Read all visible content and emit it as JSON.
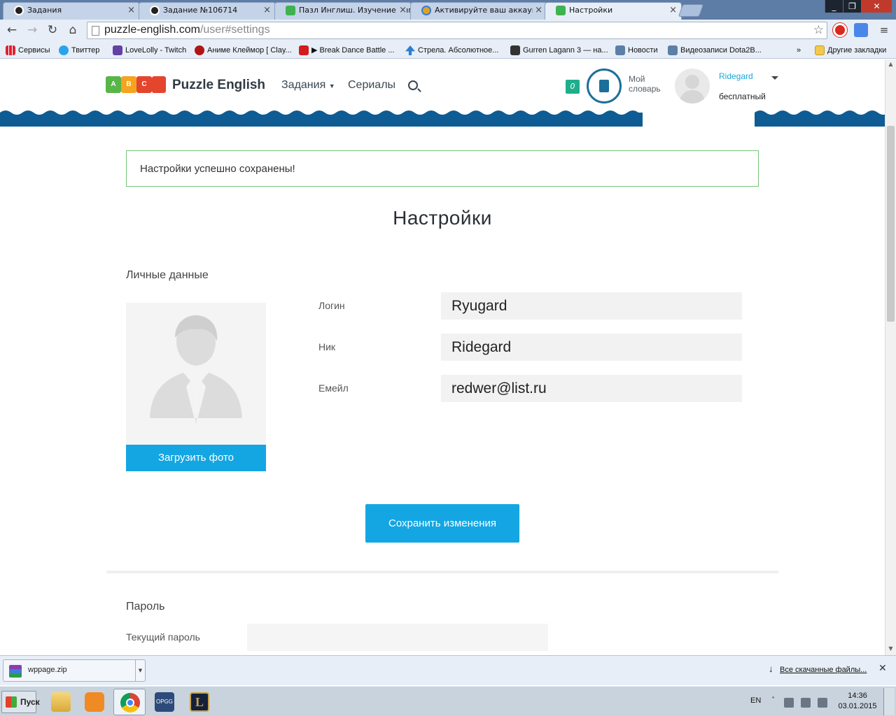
{
  "browser": {
    "tabs": [
      {
        "label": "Задания",
        "icon": "circle-dark-icon"
      },
      {
        "label": "Задание №106714",
        "icon": "circle-dark-icon"
      },
      {
        "label": "Пазл Инглиш. Изучение анг",
        "icon": "puzzle-icon"
      },
      {
        "label": "Активируйте ваш аккаунт",
        "icon": "activate-icon"
      },
      {
        "label": "Настройки",
        "icon": "puzzle-icon",
        "active": true
      }
    ],
    "address": {
      "domain": "puzzle-english.com",
      "path": "/user#settings"
    },
    "bookmarks": [
      {
        "label": "Сервисы",
        "icon": "apps-grid-icon"
      },
      {
        "label": "Твиттер",
        "icon": "twitter-icon"
      },
      {
        "label": "LoveLolly - Twitch",
        "icon": "twitch-icon"
      },
      {
        "label": "Аниме Клеймор [ Clay...",
        "icon": "anime-icon"
      },
      {
        "label": "▶ Break Dance Battle ...",
        "icon": "youtube-icon"
      },
      {
        "label": "Стрела. Абсолютное...",
        "icon": "arrow-up-icon"
      },
      {
        "label": "Gurren Lagann 3 — на...",
        "icon": "play-icon"
      },
      {
        "label": "Новости",
        "icon": "vk-icon"
      },
      {
        "label": "Видеозаписи Dota2B...",
        "icon": "vk-icon"
      }
    ],
    "bookmarks_more": "»",
    "other_bookmarks": "Другие закладки"
  },
  "site": {
    "logo_letters": [
      "A",
      "B",
      "C"
    ],
    "logo_text": "Puzzle English",
    "nav": {
      "tasks": "Задания",
      "series": "Сериалы"
    },
    "dictionary": {
      "count": "0",
      "label": "Мой словарь"
    },
    "user": {
      "name": "Ridegard",
      "plan": "бесплатный"
    }
  },
  "page": {
    "alert": "Настройки успешно сохранены!",
    "title": "Настройки",
    "personal_title": "Личные данные",
    "upload_button": "Загрузить фото",
    "fields": {
      "login_label": "Логин",
      "login_value": "Ryugard",
      "nick_label": "Ник",
      "nick_value": "Ridegard",
      "email_label": "Емейл",
      "email_value": "redwer@list.ru"
    },
    "save_button": "Сохранить изменения",
    "password_title": "Пароль",
    "current_password_label": "Текущий пароль"
  },
  "downloads": {
    "file": "wppage.zip",
    "all_downloads": "Все скачанные файлы..."
  },
  "taskbar": {
    "start": "Пуск",
    "apps": [
      "explorer-icon",
      "media-player-icon",
      "chrome-icon",
      "opgg-icon",
      "league-icon"
    ],
    "opgg_label": "OPGG",
    "language": "EN",
    "time": "14:36",
    "date": "03.01.2015"
  },
  "colors": {
    "accent": "#14a6e3",
    "success_border": "#75c479",
    "wave": "#0e5c93",
    "dict": "#1fae8c"
  }
}
